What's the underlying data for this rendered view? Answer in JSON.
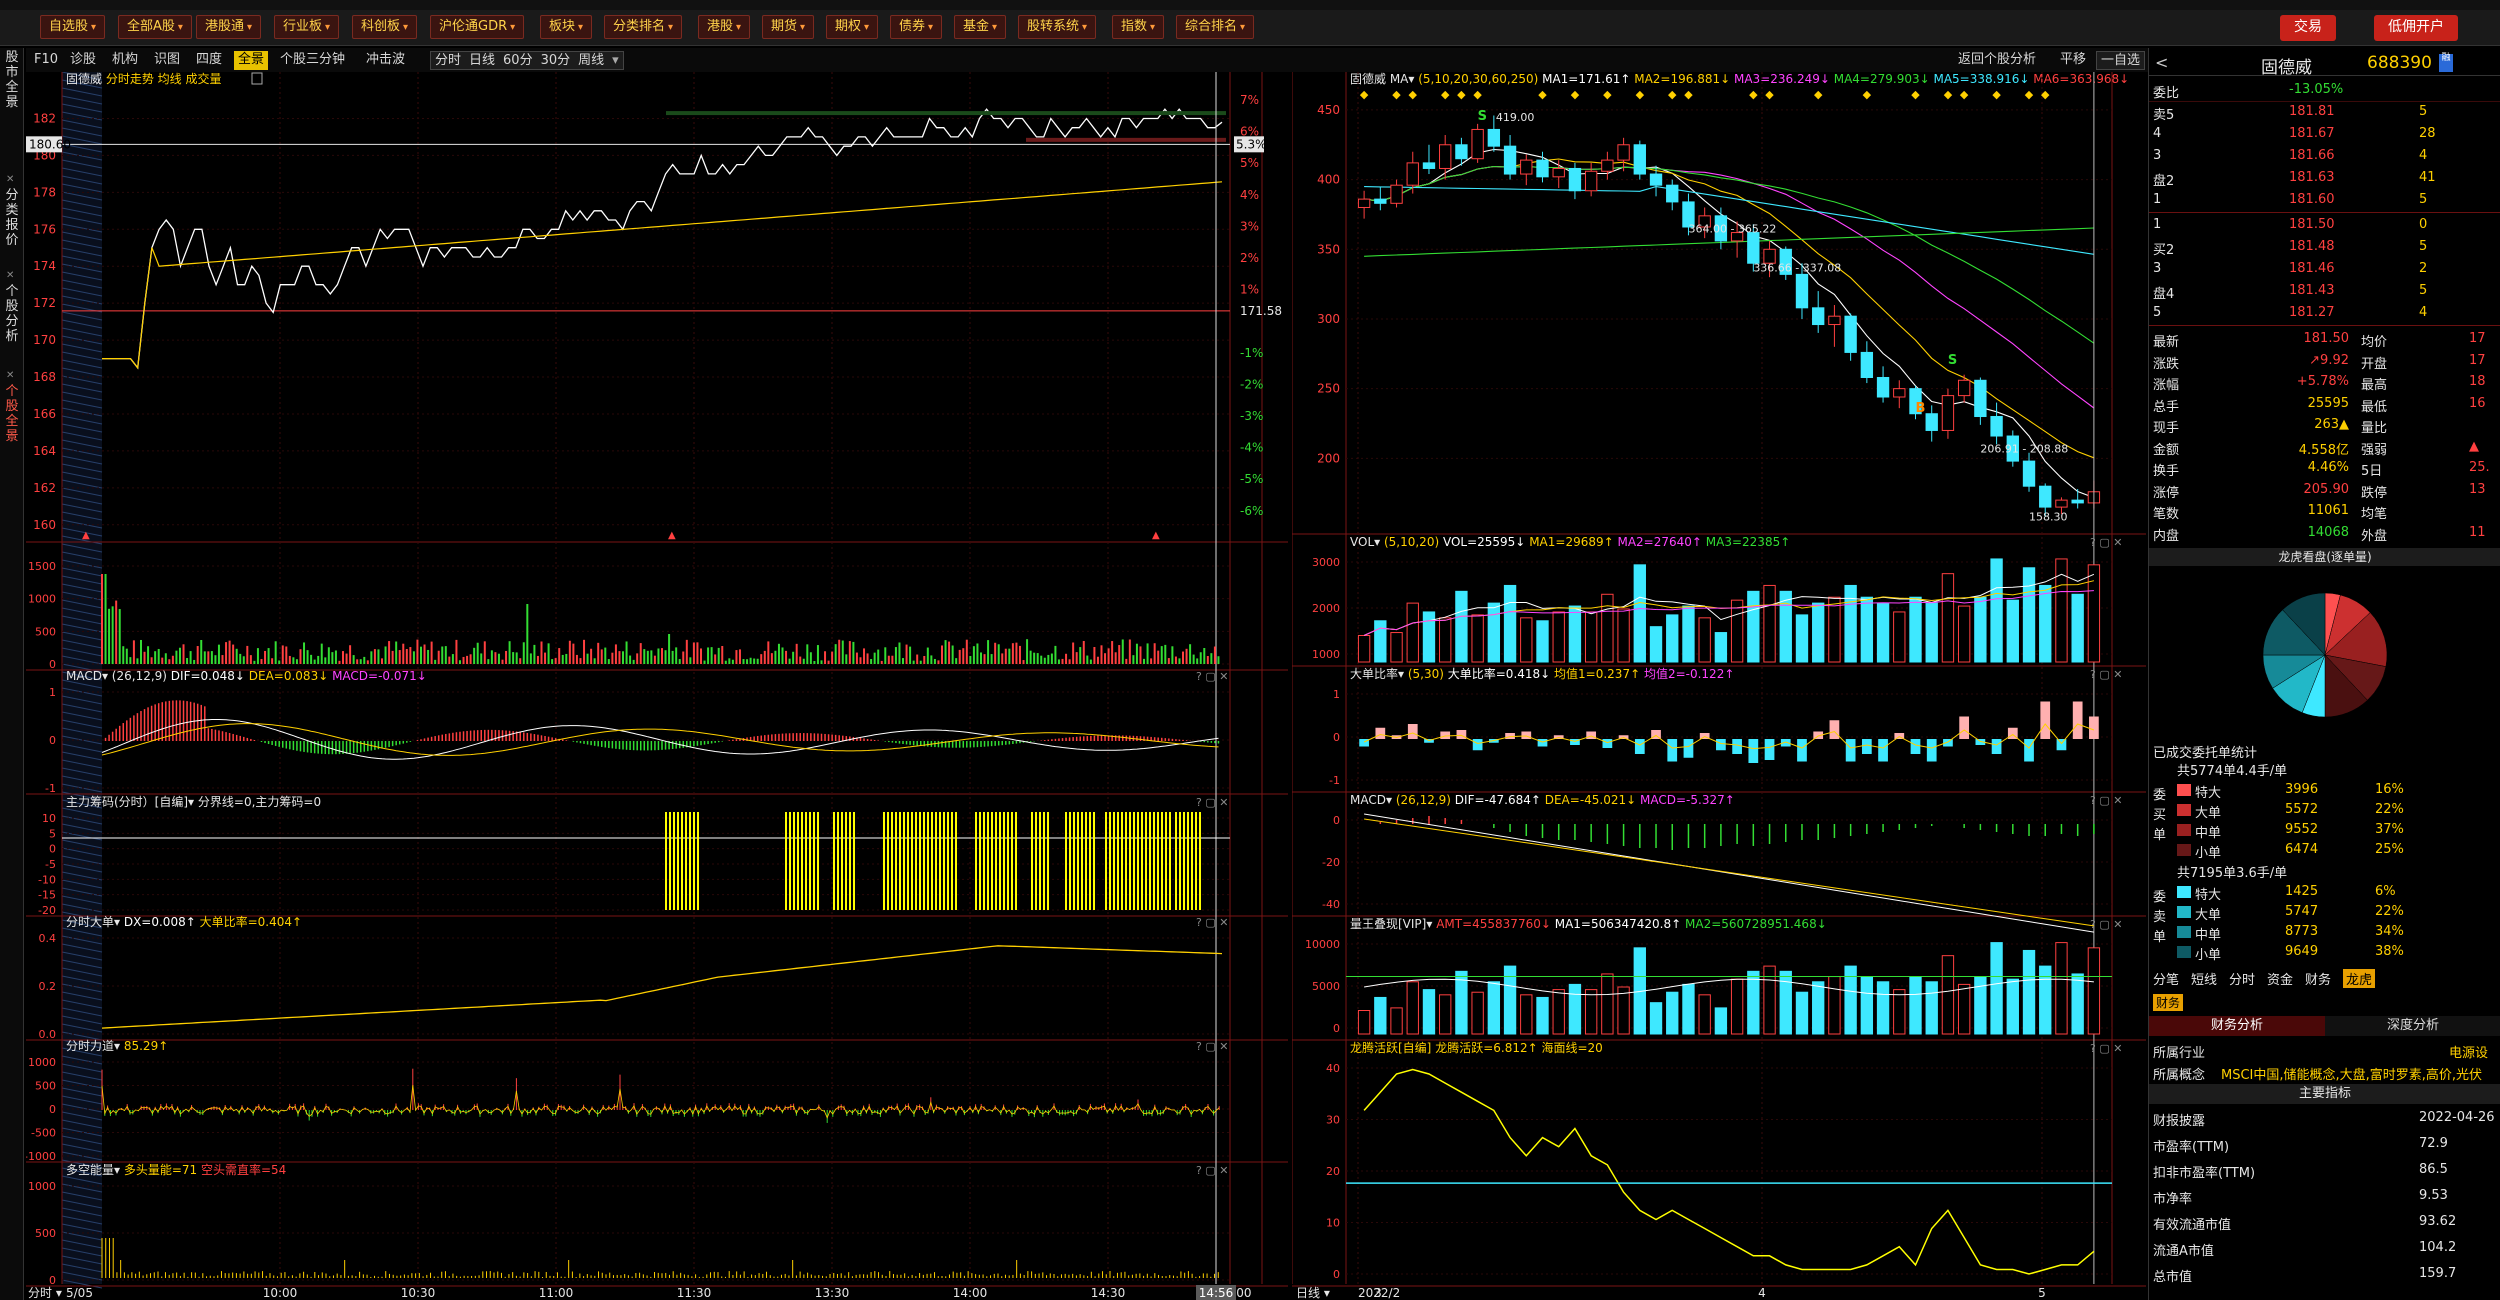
{
  "toolbar": {
    "buttons": [
      "自选股",
      "全部A股",
      "港股通",
      "行业板",
      "科创板",
      "沪伦通GDR",
      "板块",
      "分类排名",
      "港股",
      "期货",
      "期权",
      "债券",
      "基金",
      "股转系统",
      "指数",
      "综合排名"
    ],
    "trade_label": "交易",
    "open_account_label": "低佣开户"
  },
  "subbar": {
    "left": [
      "F10",
      "诊股",
      "机构",
      "识图",
      "四度",
      "全景",
      "个股三分钟",
      "冲击波"
    ],
    "active": "全景",
    "periods": [
      "分时",
      "日线",
      "60分",
      "30分",
      "周线"
    ],
    "right": [
      "返回个股分析",
      "平移",
      "一自选"
    ]
  },
  "lefttabs": [
    "股市全景",
    "分类报价",
    "个股分析",
    "个股全景"
  ],
  "stock": {
    "name": "固德威",
    "code": "688390"
  },
  "intraday": {
    "title_name": "固德威",
    "title_rest": "分时走势 均线 成交量",
    "price_ticks": [
      "182",
      "180",
      "178",
      "176",
      "174",
      "172",
      "170",
      "168",
      "166",
      "164",
      "162",
      "160"
    ],
    "pct_ticks": [
      "7%",
      "6%",
      "5%",
      "4%",
      "3%",
      "2%",
      "1%",
      "",
      "-1%",
      "-2%",
      "-3%",
      "-4%",
      "-5%",
      "-6%"
    ],
    "pct_mid": "171.58",
    "cur_price": "180.60",
    "cur_pct": "5.3%",
    "time_labels": [
      "5/05",
      "10:00",
      "10:30",
      "11:00",
      "11:30",
      "13:30",
      "14:00",
      "14:30",
      "5:00"
    ],
    "cur_time": "14:56",
    "footer_left": "分时",
    "points": [
      169,
      169,
      169,
      169,
      169,
      168.5,
      172,
      175,
      176,
      176.5,
      176,
      174,
      175,
      176,
      176,
      174,
      173,
      174,
      175,
      173,
      173,
      174,
      173.5,
      172,
      171.5,
      173,
      173,
      173,
      174,
      174,
      173,
      173,
      172.5,
      173,
      174,
      175,
      175,
      174,
      175,
      176,
      175.5,
      176,
      176,
      176,
      175,
      174,
      175,
      175,
      174.5,
      175,
      175,
      175,
      174.5,
      174.5,
      175,
      174.5,
      174.5,
      175,
      175,
      176,
      176,
      175.5,
      175.5,
      176,
      176,
      177,
      176.5,
      177,
      176.5,
      177,
      177,
      176.5,
      176.5,
      176,
      177,
      177.5,
      177.5,
      177,
      178,
      179,
      179.5,
      179,
      179,
      179,
      180,
      179,
      179,
      179.5,
      179,
      179.5,
      179.5,
      180,
      180.5,
      180,
      180,
      180.5,
      181,
      181,
      181,
      181.5,
      181,
      181,
      180.5,
      180,
      180.5,
      180.5,
      181,
      181,
      180.5,
      181,
      181.5,
      181,
      181,
      181,
      181,
      181,
      182,
      181.5,
      181.5,
      181,
      181,
      181.5,
      181,
      182,
      182.5,
      182,
      182,
      181.5,
      182,
      182,
      181.5,
      181,
      181,
      182,
      181.5,
      181,
      181.5,
      181.5,
      182,
      181.5,
      181,
      181.5,
      181,
      182,
      182,
      181.5,
      182,
      182,
      182,
      182.5,
      182,
      182.5,
      182,
      182,
      182,
      181.5,
      181.5,
      181.8
    ]
  },
  "indicators_left": [
    {
      "title": "",
      "yticks": [
        "1500",
        "1000",
        "500",
        "0"
      ]
    },
    {
      "title": "MACD▾ (26,12,9)",
      "values": [
        {
          "t": "DIF=0.048↓",
          "c": "#ffffff"
        },
        {
          "t": "DEA=0.083↓",
          "c": "#ffd000"
        },
        {
          "t": "MACD=-0.071↓",
          "c": "#ff44ff"
        }
      ],
      "yticks": [
        "1",
        "0",
        "-1"
      ]
    },
    {
      "title": "主力筹码(分时）[自编]▾ 分界线=0,主力筹码=0",
      "values": [],
      "yticks": [
        "10",
        "5",
        "0",
        "-5",
        "-10",
        "-15",
        "-20"
      ]
    },
    {
      "title": "分时大单▾",
      "values": [
        {
          "t": "DX=0.008↑",
          "c": "#ffffff"
        },
        {
          "t": "大单比率=0.404↑",
          "c": "#ffd000"
        }
      ],
      "yticks": [
        "0.4",
        "0.2",
        "0.0"
      ]
    },
    {
      "title": "分时力道▾",
      "values": [
        {
          "t": "85.29↑",
          "c": "#ffd000"
        }
      ],
      "yticks": [
        "1000",
        "500",
        "0",
        "-500",
        "-1000"
      ]
    },
    {
      "title": "多空能量▾",
      "values": [
        {
          "t": "多头量能=71",
          "c": "#ffd000"
        },
        {
          "t": "空头需直率=54",
          "c": "#ff4040"
        }
      ],
      "yticks": [
        "1000",
        "500",
        "0"
      ]
    }
  ],
  "kline": {
    "title_name": "固德威",
    "title_params": "MA▾ (5,10,20,30,60,250)",
    "ma_values": [
      {
        "t": "MA1=171.61↑",
        "c": "#ffffff"
      },
      {
        "t": "MA2=196.881↓",
        "c": "#ffd000"
      },
      {
        "t": "MA3=236.249↓",
        "c": "#ff44ff"
      },
      {
        "t": "MA4=279.903↓",
        "c": "#33dd33"
      },
      {
        "t": "MA5=338.916↓",
        "c": "#3ee8ff"
      },
      {
        "t": "MA6=363.968↓",
        "c": "#ff4040"
      }
    ],
    "yticks": [
      "450",
      "400",
      "350",
      "300",
      "250",
      "200"
    ],
    "annotations": [
      "419.00",
      "364.00 - 365.22",
      "336.66 - 337.08",
      "206.91 - 208.88",
      "158.30"
    ],
    "date_labels": [
      "2022/2",
      "3",
      "4",
      "5"
    ],
    "footer_left": "日线",
    "candles": [
      [
        380,
        392,
        372,
        386
      ],
      [
        386,
        395,
        378,
        383
      ],
      [
        383,
        400,
        380,
        396
      ],
      [
        396,
        420,
        390,
        412
      ],
      [
        412,
        425,
        404,
        408
      ],
      [
        408,
        432,
        400,
        425
      ],
      [
        425,
        430,
        410,
        415
      ],
      [
        415,
        440,
        412,
        436
      ],
      [
        436,
        446,
        420,
        424
      ],
      [
        424,
        432,
        400,
        404
      ],
      [
        404,
        418,
        396,
        414
      ],
      [
        414,
        420,
        398,
        402
      ],
      [
        402,
        414,
        394,
        408
      ],
      [
        408,
        412,
        386,
        392
      ],
      [
        392,
        412,
        388,
        406
      ],
      [
        406,
        420,
        400,
        414
      ],
      [
        414,
        430,
        406,
        425
      ],
      [
        425,
        428,
        400,
        404
      ],
      [
        404,
        410,
        388,
        396
      ],
      [
        396,
        400,
        378,
        384
      ],
      [
        384,
        390,
        360,
        366
      ],
      [
        366,
        380,
        358,
        374
      ],
      [
        374,
        380,
        350,
        356
      ],
      [
        356,
        370,
        344,
        362
      ],
      [
        362,
        368,
        334,
        340
      ],
      [
        340,
        356,
        330,
        350
      ],
      [
        350,
        352,
        328,
        332
      ],
      [
        332,
        340,
        300,
        308
      ],
      [
        308,
        320,
        290,
        296
      ],
      [
        296,
        310,
        280,
        302
      ],
      [
        302,
        304,
        270,
        276
      ],
      [
        276,
        284,
        254,
        258
      ],
      [
        258,
        266,
        240,
        244
      ],
      [
        244,
        256,
        236,
        250
      ],
      [
        250,
        252,
        228,
        232
      ],
      [
        232,
        238,
        212,
        220
      ],
      [
        220,
        250,
        214,
        245
      ],
      [
        245,
        260,
        240,
        256
      ],
      [
        256,
        258,
        224,
        230
      ],
      [
        230,
        240,
        210,
        216
      ],
      [
        216,
        220,
        194,
        198
      ],
      [
        198,
        204,
        176,
        180
      ],
      [
        180,
        182,
        158,
        165
      ],
      [
        165,
        172,
        160,
        170
      ],
      [
        170,
        178,
        164,
        168
      ],
      [
        168,
        184,
        164,
        176
      ]
    ],
    "vol": [
      900,
      1400,
      1000,
      2000,
      1700,
      1500,
      2400,
      1600,
      2000,
      2600,
      1500,
      1400,
      1700,
      1900,
      1700,
      2300,
      1800,
      3300,
      1200,
      1600,
      1900,
      1500,
      1000,
      2100,
      2400,
      2600,
      2400,
      1600,
      2000,
      2200,
      2600,
      2200,
      2000,
      1700,
      2200,
      2000,
      3000,
      1900,
      2200,
      3500,
      2100,
      3200,
      2600,
      3500,
      2300,
      3300
    ],
    "big": [
      -0.1,
      0.15,
      0.05,
      0.2,
      -0.05,
      0.1,
      0.12,
      -0.15,
      -0.05,
      0.08,
      0.1,
      -0.1,
      0.05,
      -0.08,
      0.1,
      -0.12,
      0.05,
      -0.2,
      0.12,
      -0.3,
      -0.25,
      0.08,
      -0.15,
      -0.2,
      -0.32,
      -0.28,
      -0.1,
      -0.3,
      0.1,
      0.25,
      -0.3,
      -0.2,
      -0.3,
      0.08,
      -0.2,
      -0.3,
      -0.1,
      0.3,
      -0.08,
      -0.2,
      0.15,
      -0.3,
      0.5,
      -0.15,
      0.5,
      0.3
    ],
    "macd_hist": [
      0,
      1,
      2,
      3,
      4,
      3,
      2,
      0,
      -2,
      -4,
      -6,
      -7,
      -8,
      -8,
      -9,
      -10,
      -11,
      -12,
      -12,
      -13,
      -12,
      -12,
      -11,
      -10,
      -11,
      -10,
      -9,
      -8,
      -8,
      -7,
      -6,
      -5,
      -4,
      -3,
      -2,
      -1,
      0,
      -2,
      -3,
      -4,
      -5,
      -6,
      -6,
      -5,
      -6,
      -5
    ]
  },
  "indicators_mid": [
    {
      "title": "VOL▾",
      "params": "(5,10,20)",
      "values": [
        {
          "t": "VOL=25595↓",
          "c": "#ffffff"
        },
        {
          "t": "MA1=29689↑",
          "c": "#ffd000"
        },
        {
          "t": "MA2=27640↑",
          "c": "#ff44ff"
        },
        {
          "t": "MA3=22385↑",
          "c": "#33dd33"
        }
      ],
      "yticks": [
        "3000",
        "2000",
        "1000"
      ]
    },
    {
      "title": "大单比率▾",
      "params": "(5,30)",
      "values": [
        {
          "t": "大单比率=0.418↓",
          "c": "#ffffff"
        },
        {
          "t": "均值1=0.237↑",
          "c": "#ffd000"
        },
        {
          "t": "均值2=-0.122↑",
          "c": "#ff44ff"
        }
      ],
      "yticks": [
        "1",
        "0",
        "-1"
      ]
    },
    {
      "title": "MACD▾",
      "params": "(26,12,9)",
      "values": [
        {
          "t": "DIF=-47.684↑",
          "c": "#ffffff"
        },
        {
          "t": "DEA=-45.021↓",
          "c": "#ffd000"
        },
        {
          "t": "MACD=-5.327↑",
          "c": "#ff44ff"
        }
      ],
      "yticks": [
        "0",
        "-20",
        "-40"
      ]
    },
    {
      "title": "量王叠现[VIP]▾",
      "params": "",
      "values": [
        {
          "t": "AMT=455837760↓",
          "c": "#ff4040"
        },
        {
          "t": "MA1=506347420.8↑",
          "c": "#ffffff"
        },
        {
          "t": "MA2=560728951.468↓",
          "c": "#33dd33"
        }
      ],
      "yticks": [
        "10000",
        "5000",
        "0"
      ]
    },
    {
      "title": "龙腾活跃[自编]",
      "params": "",
      "values": [
        {
          "t": "龙腾活跃=6.812↑",
          "c": "#ffd000"
        },
        {
          "t": "海面线=20",
          "c": "#ffd000"
        }
      ],
      "yticks": [
        "40",
        "30",
        "20",
        "10",
        "0"
      ]
    }
  ],
  "quote": {
    "header_name": "固德威",
    "header_code": "688390",
    "webi_label": "委比",
    "webi_value": "-13.05%",
    "sell": [
      {
        "l": "卖5",
        "p": "181.81",
        "v": "5"
      },
      {
        "l": "4",
        "p": "181.67",
        "v": "28"
      },
      {
        "l": "3",
        "p": "181.66",
        "v": "4"
      },
      {
        "l": "盘2",
        "p": "181.63",
        "v": "41"
      },
      {
        "l": "1",
        "p": "181.60",
        "v": "5"
      }
    ],
    "buy": [
      {
        "l": "1",
        "p": "181.50",
        "v": "0"
      },
      {
        "l": "买2",
        "p": "181.48",
        "v": "5"
      },
      {
        "l": "3",
        "p": "181.46",
        "v": "2"
      },
      {
        "l": "盘4",
        "p": "181.43",
        "v": "5"
      },
      {
        "l": "5",
        "p": "181.27",
        "v": "4"
      }
    ],
    "stats": [
      {
        "a": "最新",
        "b": "181.50",
        "bc": "c-red",
        "c": "均价",
        "d": "17"
      },
      {
        "a": "涨跌",
        "b": "↗9.92",
        "bc": "c-red",
        "c": "开盘",
        "d": "17"
      },
      {
        "a": "涨幅",
        "b": "+5.78%",
        "bc": "c-red",
        "c": "最高",
        "d": "18"
      },
      {
        "a": "总手",
        "b": "25595",
        "bc": "c-yel",
        "c": "最低",
        "d": "16"
      },
      {
        "a": "现手",
        "b": "263▲",
        "bc": "c-yel",
        "c": "量比",
        "d": ""
      },
      {
        "a": "金额",
        "b": "4.558亿",
        "bc": "c-yel",
        "c": "强弱",
        "d": "▲"
      },
      {
        "a": "换手",
        "b": "4.46%",
        "bc": "c-yel",
        "c": "5日",
        "d": "25."
      },
      {
        "a": "涨停",
        "b": "205.90",
        "bc": "c-red",
        "c": "跌停",
        "d": "13"
      },
      {
        "a": "笔数",
        "b": "11061",
        "bc": "c-yel",
        "c": "均笔",
        "d": ""
      },
      {
        "a": "内盘",
        "b": "14068",
        "bc": "c-green",
        "c": "外盘",
        "d": "11"
      }
    ],
    "pie_title": "龙虎看盘(逐单量)",
    "pie_slices": [
      0.04,
      0.09,
      0.15,
      0.1,
      0.12,
      0.06,
      0.1,
      0.09,
      0.13,
      0.12
    ],
    "entrust_title": "已成交委托单统计",
    "buy_block": {
      "head": "共5774单4.4手/单",
      "rows": [
        {
          "n": "特大",
          "v": "3996",
          "p": "16%",
          "c": "#ff5050"
        },
        {
          "n": "大单",
          "v": "5572",
          "p": "22%",
          "c": "#cc3030"
        },
        {
          "n": "中单",
          "v": "9552",
          "p": "37%",
          "c": "#992020"
        },
        {
          "n": "小单",
          "v": "6474",
          "p": "25%",
          "c": "#661818"
        }
      ],
      "side": [
        "委",
        "买",
        "单"
      ]
    },
    "sell_block": {
      "head": "共7195单3.6手/单",
      "rows": [
        {
          "n": "特大",
          "v": "1425",
          "p": "6%",
          "c": "#3ee8ff"
        },
        {
          "n": "大单",
          "v": "5747",
          "p": "22%",
          "c": "#22b8c8"
        },
        {
          "n": "中单",
          "v": "8773",
          "p": "34%",
          "c": "#168a98"
        },
        {
          "n": "小单",
          "v": "9649",
          "p": "38%",
          "c": "#0e5a64"
        }
      ],
      "side": [
        "委",
        "卖",
        "单"
      ]
    },
    "bottom_tabs": [
      "分笔",
      "短线",
      "分时",
      "资金",
      "财务",
      "龙虎"
    ],
    "fin_tab": "财务",
    "fin_tabs": [
      "财务分析",
      "深度分析"
    ],
    "industry_label": "所属行业",
    "industry_value": "电源设",
    "concept_label": "所属概念",
    "concept_value": "MSCI中国,储能概念,大盘,富时罗素,高价,光伏",
    "main_index": "主要指标",
    "fin_rows": [
      {
        "a": "财报披露",
        "b": "2022-04-26"
      },
      {
        "a": "市盈率(TTM)",
        "b": "72.9"
      },
      {
        "a": "扣非市盈率(TTM)",
        "b": "86.5"
      },
      {
        "a": "市净率",
        "b": "9.53"
      },
      {
        "a": "有效流通市值",
        "b": "93.62"
      },
      {
        "a": "流通A市值",
        "b": "104.2"
      },
      {
        "a": "总市值",
        "b": "159.7"
      }
    ]
  }
}
